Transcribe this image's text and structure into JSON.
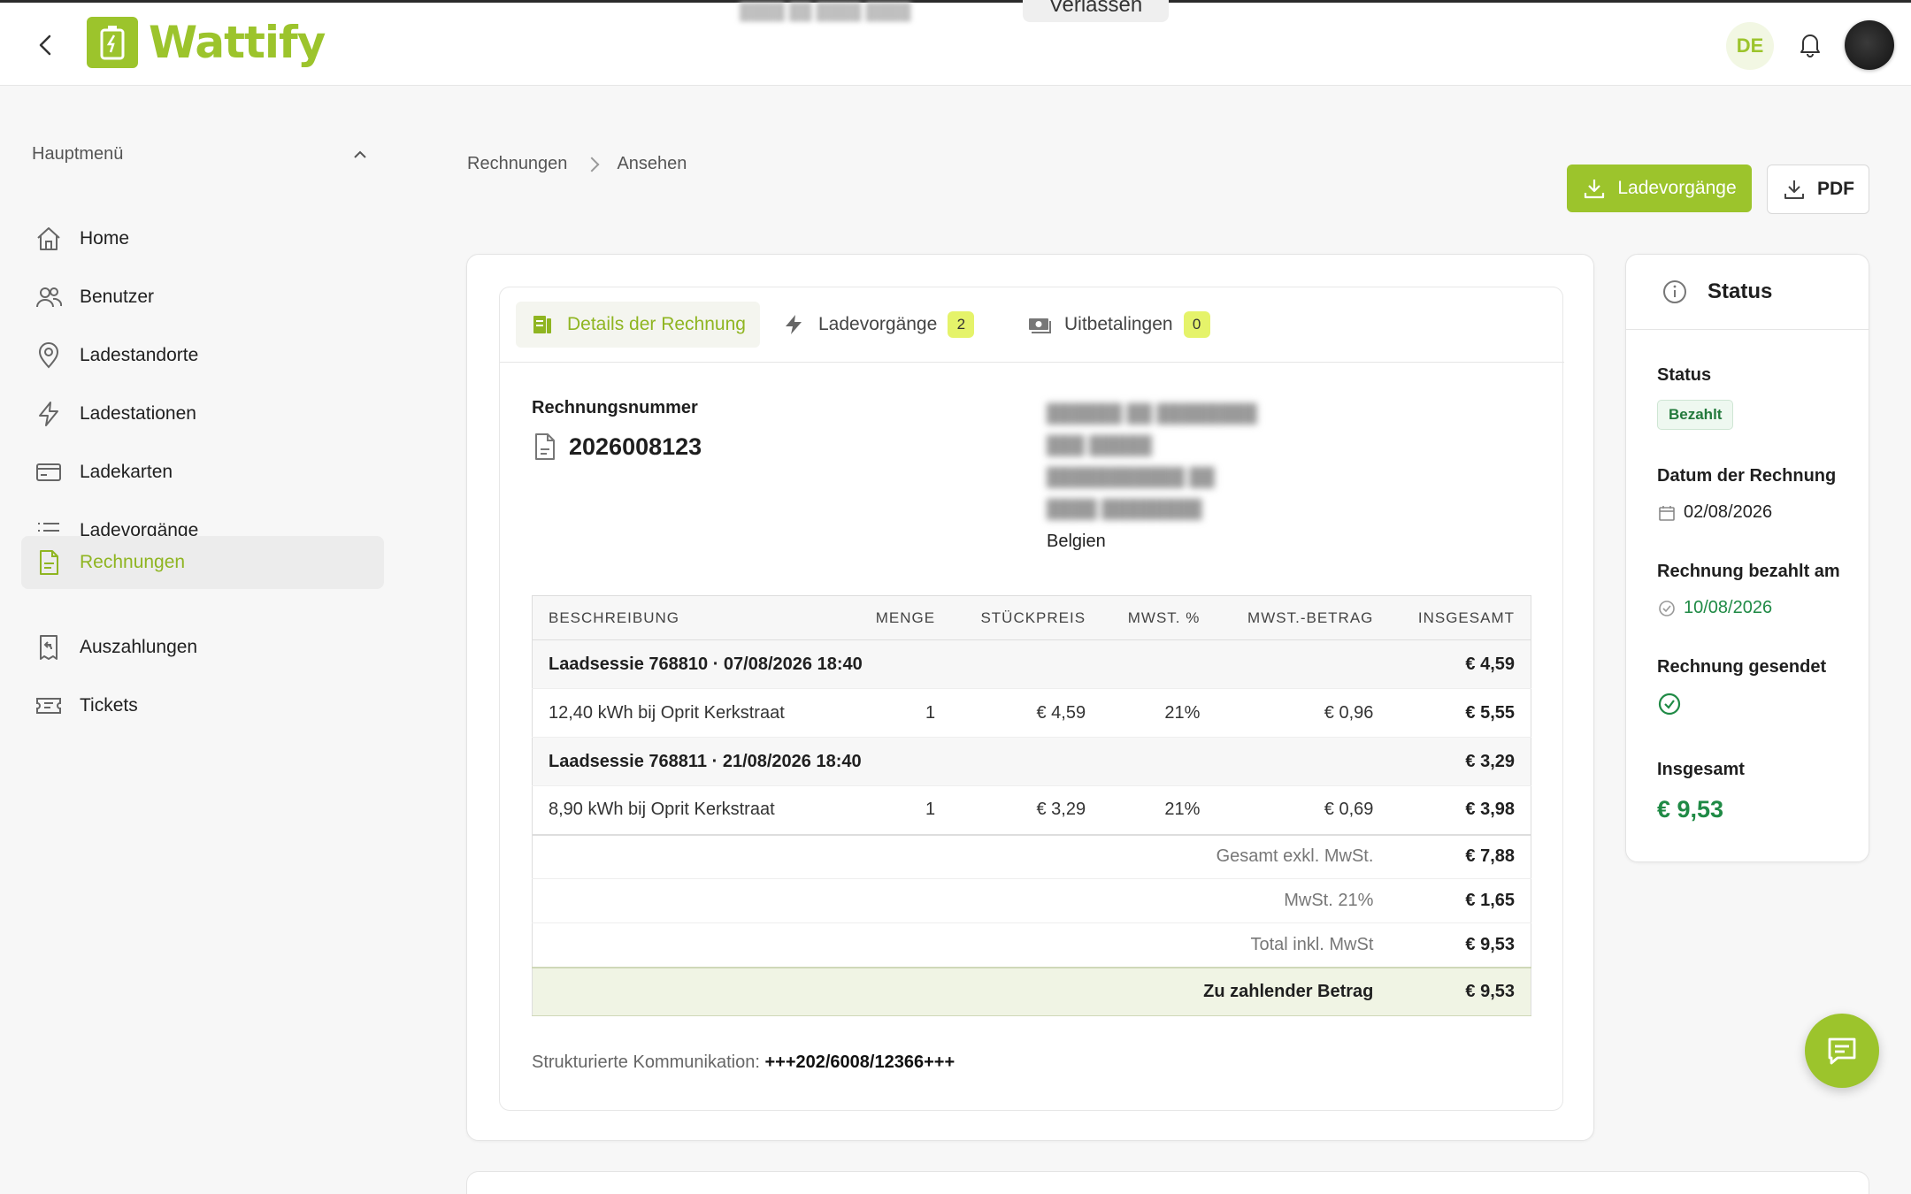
{
  "app": {
    "name": "Wattify",
    "language": "DE",
    "leave_label": "Verlassen"
  },
  "sidebar": {
    "section_title": "Hauptmenü",
    "items": [
      {
        "label": "Home",
        "icon": "home-icon"
      },
      {
        "label": "Benutzer",
        "icon": "users-icon"
      },
      {
        "label": "Ladestandorte",
        "icon": "location-pin-icon"
      },
      {
        "label": "Ladestationen",
        "icon": "lightning-icon"
      },
      {
        "label": "Ladekarten",
        "icon": "card-icon"
      },
      {
        "label": "Ladevorgänge",
        "icon": "list-icon"
      },
      {
        "label": "Rechnungen",
        "icon": "invoice-icon",
        "active": true
      },
      {
        "label": "Auszahlungen",
        "icon": "receipt-return-icon"
      },
      {
        "label": "Tickets",
        "icon": "ticket-icon"
      }
    ]
  },
  "breadcrumb": {
    "root": "Rechnungen",
    "current": "Ansehen"
  },
  "actions": {
    "sessions_download": "Ladevorgänge",
    "pdf": "PDF"
  },
  "tabs": [
    {
      "label": "Details der Rechnung",
      "active": true
    },
    {
      "label": "Ladevorgänge",
      "count": "2"
    },
    {
      "label": "Uitbetalingen",
      "count": "0"
    }
  ],
  "invoice": {
    "number_label": "Rechnungsnummer",
    "number": "2026008123",
    "address_country": "Belgien",
    "table": {
      "headers": [
        "BESCHREIBUNG",
        "MENGE",
        "STÜCKPREIS",
        "MWST. %",
        "MWST.-BETRAG",
        "INSGESAMT"
      ],
      "rows": [
        {
          "type": "session",
          "description": "Laadsessie 768810 · 07/08/2026 18:40",
          "total": "€ 4,59"
        },
        {
          "type": "line",
          "description": "12,40 kWh bij Oprit Kerkstraat",
          "qty": "1",
          "unit_price": "€ 4,59",
          "vat_pct": "21%",
          "vat_amount": "€ 0,96",
          "total": "€ 5,55"
        },
        {
          "type": "session",
          "description": "Laadsessie 768811 · 21/08/2026 18:40",
          "total": "€ 3,29"
        },
        {
          "type": "line",
          "description": "8,90 kWh bij Oprit Kerkstraat",
          "qty": "1",
          "unit_price": "€ 3,29",
          "vat_pct": "21%",
          "vat_amount": "€ 0,69",
          "total": "€ 3,98"
        }
      ],
      "subtotal_label": "Gesamt exkl. MwSt.",
      "subtotal": "€ 7,88",
      "vat_label": "MwSt. 21%",
      "vat": "€ 1,65",
      "total_label": "Total inkl. MwSt",
      "total": "€ 9,53",
      "due_label": "Zu zahlender Betrag",
      "due": "€ 9,53"
    },
    "structured_comm_label": "Strukturierte Kommunikation:",
    "structured_comm": "+++202/6008/12366+++"
  },
  "status_panel": {
    "title": "Status",
    "status_label": "Status",
    "status_value": "Bezahlt",
    "date_label": "Datum der Rechnung",
    "date_value": "02/08/2026",
    "paid_label": "Rechnung bezahlt am",
    "paid_value": "10/08/2026",
    "sent_label": "Rechnung gesendet",
    "total_label": "Insgesamt",
    "total_value": "€ 9,53"
  },
  "colors": {
    "brand": "#9cc42c",
    "paid_green": "#1f8a45",
    "count_badge": "#e5f36a"
  }
}
